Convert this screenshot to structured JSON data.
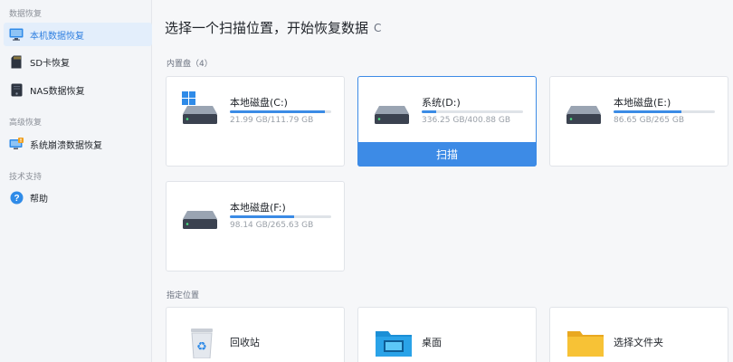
{
  "sidebar": {
    "sections": [
      {
        "title": "数据恢复",
        "items": [
          {
            "label": "本机数据恢复",
            "icon": "monitor-icon",
            "active": true
          },
          {
            "label": "SD卡恢复",
            "icon": "sd-card-icon"
          },
          {
            "label": "NAS数据恢复",
            "icon": "nas-icon"
          }
        ]
      },
      {
        "title": "高级恢复",
        "items": [
          {
            "label": "系统崩溃数据恢复",
            "icon": "system-crash-icon"
          }
        ]
      },
      {
        "title": "技术支持",
        "items": [
          {
            "label": "帮助",
            "icon": "help-icon"
          }
        ]
      }
    ]
  },
  "main": {
    "title": "选择一个扫描位置，开始恢复数据",
    "refresh_glyph": "C",
    "internal_disks_label": "内置盘（4）",
    "drives": [
      {
        "name": "本地磁盘(C:)",
        "size": "21.99 GB/111.79 GB",
        "used_fraction": 0.94,
        "system": true
      },
      {
        "name": "系统(D:)",
        "size": "336.25 GB/400.88 GB",
        "used_fraction": 0.14,
        "selected": true
      },
      {
        "name": "本地磁盘(E:)",
        "size": "86.65 GB/265 GB",
        "used_fraction": 0.67
      },
      {
        "name": "本地磁盘(F:)",
        "size": "98.14 GB/265.63 GB",
        "used_fraction": 0.63
      }
    ],
    "scan_label": "扫描",
    "location_label": "指定位置",
    "locations": [
      {
        "name": "回收站",
        "icon": "recycle-bin-icon"
      },
      {
        "name": "桌面",
        "icon": "desktop-icon"
      },
      {
        "name": "选择文件夹",
        "icon": "folder-icon"
      }
    ]
  },
  "colors": {
    "accent": "#3d8be6",
    "bar_fill": "#3b8be5",
    "bar_track": "#dfe3e8"
  }
}
